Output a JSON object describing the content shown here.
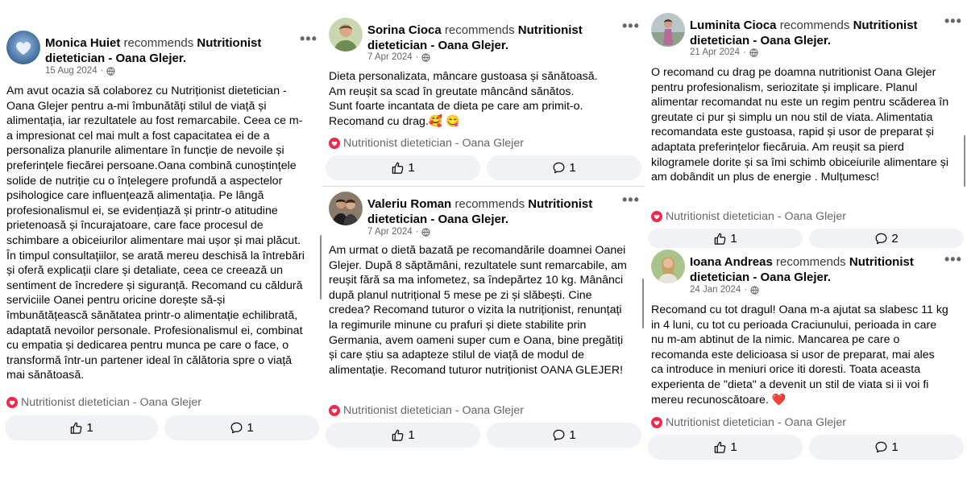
{
  "recommends_text": "recommends",
  "page_name_line1": "Nutritionist",
  "page_name_line2": "dietetician - Oana Glejer",
  "more_glyph": "•••",
  "tag_label": "Nutritionist dietetician - Oana Glejer",
  "icons": {
    "like": "thumb-up-icon",
    "comment": "comment-icon",
    "tag": "heart-circle-icon",
    "privacy": "globe-icon",
    "more": "more-options-icon"
  },
  "colors": {
    "pill_bg": "#f0f2f5",
    "meta": "#65676b",
    "tag_heart": "#f0284a"
  },
  "posts": [
    {
      "author": "Monica Huiet",
      "date": "15 Aug 2024",
      "body": "Am avut ocazia să colaborez cu Nutriționist dietetician - Oana Glejer pentru a-mi îmbunătăți stilul de viață și alimentația, iar rezultatele au fost remarcabile. Ceea ce m-a impresionat cel mai mult a fost capacitatea ei de a personaliza planurile alimentare în funcție de nevoile și preferințele fiecărei persoane.Oana combină cunoștințele solide de nutriție cu o înțelegere profundă a aspectelor psihologice care influențează alimentația. Pe lângă profesionalismul ei, se evidențiază și printr-o atitudine prietenoasă și încurajatoare, care face procesul de schimbare a obiceiurilor alimentare mai ușor și mai plăcut. În timpul consultațiilor, se arată mereu deschisă la întrebări și oferă explicații clare și detaliate, ceea ce creează un sentiment de încredere și siguranță. Recomand cu căldură serviciile Oanei pentru oricine dorește să-și îmbunătățească sănătatea printr-o alimentație echilibrată, adaptată nevoilor personale. Profesionalismul ei, combinat cu empatia și dedicarea pentru munca pe care o face, o transformă într-un partener ideal în călătoria spre o viață mai sănătoasă.",
      "likes": "1",
      "comments": "1"
    },
    {
      "author": "Sorina Cioca",
      "date": "7 Apr 2024",
      "body": "Dieta personalizata, mâncare gustoasa și sănătoasă.\nAm reușit sa scad în greutate mâncând sănătos.\nSunt foarte incantata de dieta pe care am primit-o.\nRecomand cu drag.🥰 😋",
      "likes": "1",
      "comments": "1"
    },
    {
      "author": "Valeriu Roman",
      "date": "7 Apr 2024",
      "body": "Am urmat o dietă bazată pe recomandările doamnei Oanei Glejer. După 8 săptămâni,  rezultatele sunt remarcabile, am reușit fără sa ma infometez, sa îndepărtez 10 kg. Mânânci după planul nutrițional 5 mese pe zi și slăbești.  Cine credea? Recomand tuturor o vizita la nutriționist,  renunțați la regimurile minune cu prafuri și diete stabilite prin Germania, avem oameni super cum e Oana, bine pregătiți și care știu sa adapteze stilul de viață de modul de alimentație. Recomand tuturor nutriționist OANA GLEJER!",
      "likes": "1",
      "comments": "1"
    },
    {
      "author": "Luminita Cioca",
      "date": "21 Apr 2024",
      "body": "O recomand cu drag pe doamna nutritionist Oana Glejer pentru profesionalism, seriozitate și implicare. Planul alimentar recomandat  nu este un regim pentru scăderea în greutate  ci pur și simplu un nou stil de viata. Alimentatia recomandata este gustoasa,  rapid și usor de preparat și adaptata preferințelor fiecăruia. Am reușit sa pierd kilogramele dorite și sa îmi schimb obiceiurile alimentare și am  dobândit un plus de energie . Mulțumesc!",
      "likes": "1",
      "comments": "2"
    },
    {
      "author": "Ioana Andreas",
      "date": "24 Jan 2024",
      "body": "Recomand cu tot dragul! Oana m-a ajutat sa slabesc 11 kg in 4 luni, cu tot cu perioada Craciunului, perioada in care nu m-am abtinut de la nimic. Mancarea pe care o recomanda este delicioasa si usor de preparat, mai ales ca introduce in meniuri orice iti doresti. Toata aceasta experienta de \"dieta\" a devenit un stil de viata si ii voi fi mereu recunoscătoare. ❤️",
      "likes": "1",
      "comments": "1"
    }
  ]
}
